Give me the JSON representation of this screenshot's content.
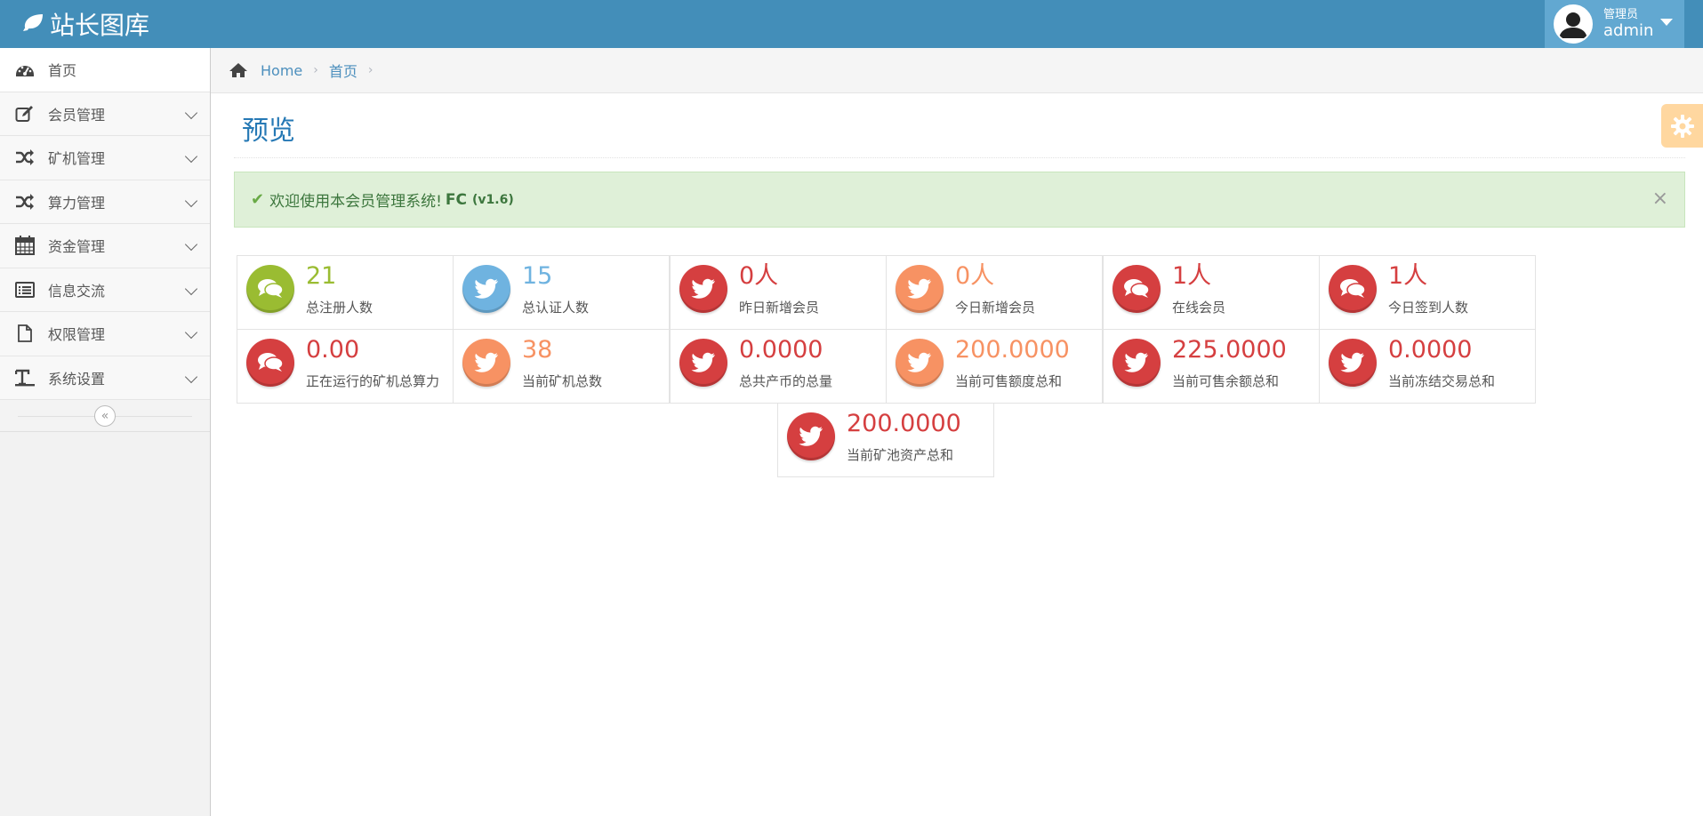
{
  "navbar": {
    "brand": "站长图库",
    "user_role": "管理员",
    "user_name": "admin"
  },
  "sidebar": {
    "items": [
      {
        "label": "首页",
        "icon": "dashboard-icon"
      },
      {
        "label": "会员管理",
        "icon": "edit-icon"
      },
      {
        "label": "矿机管理",
        "icon": "random-icon"
      },
      {
        "label": "算力管理",
        "icon": "random-icon"
      },
      {
        "label": "资金管理",
        "icon": "calendar-icon"
      },
      {
        "label": "信息交流",
        "icon": "list-icon"
      },
      {
        "label": "权限管理",
        "icon": "file-icon"
      },
      {
        "label": "系统设置",
        "icon": "text-height-icon"
      }
    ],
    "collapse_glyph": "«"
  },
  "breadcrumb": {
    "home": "Home",
    "current": "首页"
  },
  "page": {
    "title": "预览"
  },
  "alert": {
    "text": "欢迎使用本会员管理系统!",
    "brand": "FC",
    "version": "(v1.6)",
    "close": "×"
  },
  "colors": {
    "green": "#9abc32",
    "blue": "#6fb3e0",
    "red": "#d53f40",
    "orange": "#f79263",
    "navbar": "#438eb9"
  },
  "stats": [
    {
      "value": "21",
      "label": "总注册人数",
      "color": "green",
      "icon": "comments-icon"
    },
    {
      "value": "15",
      "label": "总认证人数",
      "color": "blue",
      "icon": "twitter-icon"
    },
    {
      "value": "0人",
      "label": "昨日新增会员",
      "color": "red",
      "icon": "twitter-icon"
    },
    {
      "value": "0人",
      "label": "今日新增会员",
      "color": "orange",
      "icon": "twitter-icon"
    },
    {
      "value": "1人",
      "label": "在线会员",
      "color": "red",
      "icon": "comments-icon"
    },
    {
      "value": "1人",
      "label": "今日签到人数",
      "color": "red",
      "icon": "comments-icon"
    },
    {
      "value": "0.00",
      "label": "正在运行的矿机总算力",
      "color": "red",
      "icon": "comments-icon"
    },
    {
      "value": "38",
      "label": "当前矿机总数",
      "color": "orange",
      "icon": "twitter-icon"
    },
    {
      "value": "0.0000",
      "label": "总共产币的总量",
      "color": "red",
      "icon": "twitter-icon"
    },
    {
      "value": "200.0000",
      "label": "当前可售额度总和",
      "color": "orange",
      "icon": "twitter-icon"
    },
    {
      "value": "225.0000",
      "label": "当前可售余额总和",
      "color": "red",
      "icon": "twitter-icon"
    },
    {
      "value": "0.0000",
      "label": "当前冻结交易总和",
      "color": "red",
      "icon": "twitter-icon"
    },
    {
      "value": "200.0000",
      "label": "当前矿池资产总和",
      "color": "red",
      "icon": "twitter-icon"
    }
  ]
}
